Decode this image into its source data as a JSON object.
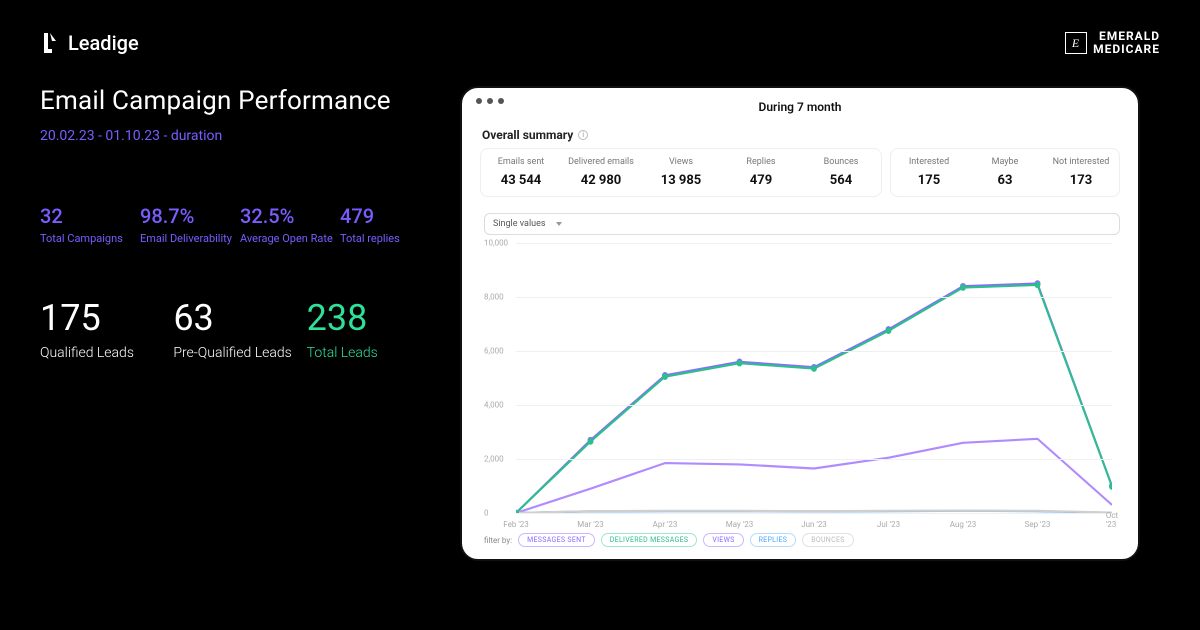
{
  "brand_left": "Leadige",
  "brand_right_top": "EMERALD",
  "brand_right_bottom": "MEDICARE",
  "title": "Email Campaign Performance",
  "date_range": "20.02.23 - 01.10.23 - duration",
  "metrics_small": [
    {
      "value": "32",
      "label": "Total Campaigns"
    },
    {
      "value": "98.7%",
      "label": "Email Deliverability"
    },
    {
      "value": "32.5%",
      "label": "Average Open Rate"
    },
    {
      "value": "479",
      "label": "Total replies"
    }
  ],
  "metrics_large": [
    {
      "value": "175",
      "label": "Qualified Leads",
      "accent": "white"
    },
    {
      "value": "63",
      "label": "Pre-Qualified Leads",
      "accent": "white"
    },
    {
      "value": "238",
      "label": "Total Leads",
      "accent": "green"
    }
  ],
  "panel": {
    "top_title": "During 7 month",
    "summary_title": "Overall summary",
    "stats_main": [
      {
        "label": "Emails sent",
        "value": "43 544"
      },
      {
        "label": "Delivered emails",
        "value": "42 980"
      },
      {
        "label": "Views",
        "value": "13 985"
      },
      {
        "label": "Replies",
        "value": "479"
      },
      {
        "label": "Bounces",
        "value": "564"
      }
    ],
    "stats_side": [
      {
        "label": "Interested",
        "value": "175"
      },
      {
        "label": "Maybe",
        "value": "63"
      },
      {
        "label": "Not interested",
        "value": "173"
      }
    ],
    "dropdown": "Single values",
    "filter_label": "filter by:",
    "filters": [
      {
        "text": "MESSAGES SENT",
        "cls": "purple"
      },
      {
        "text": "DELIVERED MESSAGES",
        "cls": "green"
      },
      {
        "text": "VIEWS",
        "cls": "purple"
      },
      {
        "text": "REPLIES",
        "cls": "blue"
      },
      {
        "text": "BOUNCES",
        "cls": "grey"
      }
    ]
  },
  "chart_data": {
    "type": "line",
    "title": "During 7 month",
    "xlabel": "",
    "ylabel": "",
    "ylim": [
      0,
      10000
    ],
    "yticks": [
      0,
      2000,
      4000,
      6000,
      8000,
      10000
    ],
    "categories": [
      "Feb '23",
      "Mar '23",
      "Apr '23",
      "May '23",
      "Jun '23",
      "Jul '23",
      "Aug '23",
      "Sep '23",
      "Oct '23"
    ],
    "series": [
      {
        "name": "Messages sent",
        "color": "#8b6bff",
        "values": [
          0,
          2700,
          5100,
          5600,
          5400,
          6800,
          8400,
          8500,
          1000
        ]
      },
      {
        "name": "Delivered messages",
        "color": "#2bbf8a",
        "values": [
          0,
          2650,
          5050,
          5550,
          5350,
          6750,
          8350,
          8450,
          980
        ]
      },
      {
        "name": "Views",
        "color": "#b08bff",
        "values": [
          0,
          900,
          1850,
          1800,
          1650,
          2050,
          2600,
          2750,
          300
        ]
      },
      {
        "name": "Replies",
        "color": "#4aa8ff",
        "values": [
          0,
          60,
          70,
          70,
          60,
          70,
          80,
          70,
          10
        ]
      },
      {
        "name": "Bounces",
        "color": "#cfcfcf",
        "values": [
          0,
          70,
          80,
          80,
          70,
          80,
          90,
          80,
          15
        ]
      }
    ]
  }
}
